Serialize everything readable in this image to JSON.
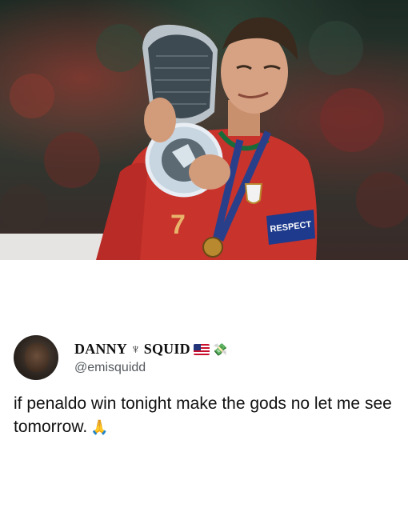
{
  "photo": {
    "armband_text": "RESPECT",
    "shirt_number": "7"
  },
  "tweet": {
    "display_name_part1": "DANNY",
    "display_name_symbol": "♆",
    "display_name_part2": "SQUID",
    "flag_icon": "us-flag-icon",
    "money_icon": "money-with-wings-icon",
    "handle": "@emisquidd",
    "text": "if penaldo win tonight make the gods no let me see tomorrow.",
    "emoji_icon": "folded-hands-icon"
  }
}
